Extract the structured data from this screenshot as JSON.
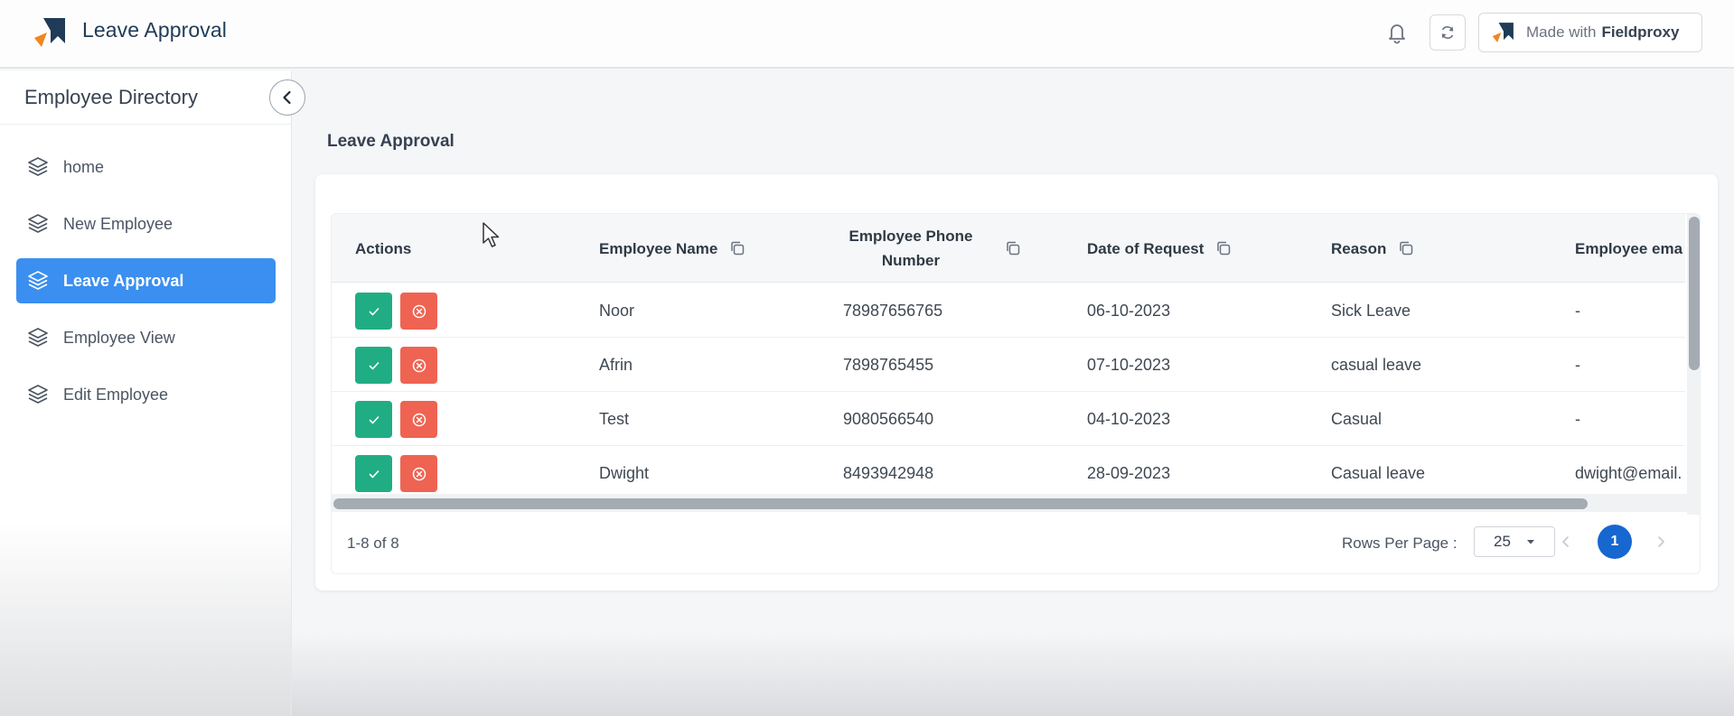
{
  "app": {
    "title": "Leave Approval",
    "brand_color": "#1f3b57",
    "accent_color": "#3b8ff0"
  },
  "header_actions": {
    "notifications_icon": "bell-icon",
    "refresh_icon": "refresh-icon",
    "made_with_prefix": "Made with",
    "made_with_brand": "Fieldproxy"
  },
  "sidebar": {
    "title": "Employee Directory",
    "collapse_icon": "chevron-left-icon",
    "items": [
      {
        "label": "home",
        "icon": "layers-icon",
        "active": false
      },
      {
        "label": "New Employee",
        "icon": "layers-icon",
        "active": false
      },
      {
        "label": "Leave Approval",
        "icon": "layers-icon",
        "active": true
      },
      {
        "label": "Employee View",
        "icon": "layers-icon",
        "active": false
      },
      {
        "label": "Edit Employee",
        "icon": "layers-icon",
        "active": false
      }
    ]
  },
  "main": {
    "heading": "Leave Approval",
    "table": {
      "columns": [
        "Actions",
        "Employee Name",
        "Employee Phone Number",
        "Date of Request",
        "Reason",
        "Employee ema"
      ],
      "rows": [
        {
          "name": "Noor",
          "phone": "78987656765",
          "date": "06-10-2023",
          "reason": "Sick Leave",
          "email": "-"
        },
        {
          "name": "Afrin",
          "phone": "7898765455",
          "date": "07-10-2023",
          "reason": "casual leave",
          "email": "-"
        },
        {
          "name": "Test",
          "phone": "9080566540",
          "date": "04-10-2023",
          "reason": "Casual",
          "email": "-"
        },
        {
          "name": "Dwight",
          "phone": "8493942948",
          "date": "28-09-2023",
          "reason": "Casual leave",
          "email": "dwight@email."
        }
      ],
      "approve_color": "#21ad84",
      "reject_color": "#ef6352"
    },
    "pagination": {
      "range": "1-8 of 8",
      "rows_per_page_label": "Rows Per Page :",
      "rows_per_page_value": "25",
      "current_page": "1"
    }
  }
}
